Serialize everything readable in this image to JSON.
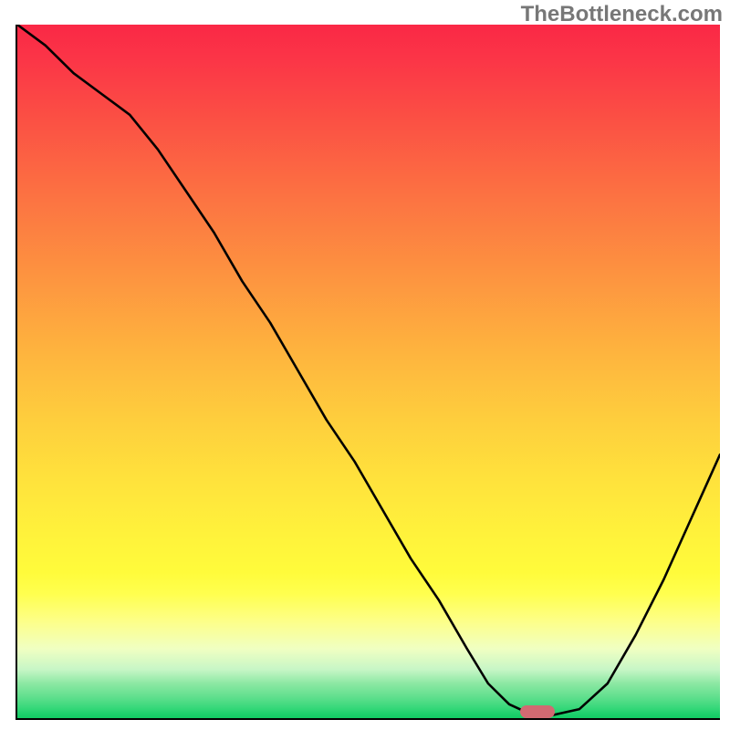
{
  "watermark": "TheBottleneck.com",
  "colors": {
    "gradient_top": "#fa2846",
    "gradient_mid": "#fed53c",
    "gradient_bottom": "#12cc63",
    "curve": "#000000",
    "marker": "#d16a72",
    "axis": "#000000",
    "watermark_text": "#777777"
  },
  "chart_data": {
    "type": "line",
    "title": "",
    "xlabel": "",
    "ylabel": "",
    "xlim": [
      0,
      100
    ],
    "ylim": [
      0,
      100
    ],
    "grid": false,
    "legend_position": "none",
    "note": "Bottleneck curve; y≈100 means extreme bottleneck, y≈0 means balanced. No numeric tick labels are shown on the image so values are read approximately from pixel position scaled to 0–100.",
    "series": [
      {
        "name": "bottleneck-curve",
        "x": [
          0,
          4,
          8,
          12,
          16,
          20,
          24,
          28,
          32,
          36,
          40,
          44,
          48,
          52,
          56,
          60,
          64,
          67,
          70,
          73,
          76,
          80,
          84,
          88,
          92,
          96,
          100
        ],
        "y": [
          100,
          97,
          93,
          90,
          87,
          82,
          76,
          70,
          63,
          57,
          50,
          43,
          37,
          30,
          23,
          17,
          10,
          5,
          2,
          0.6,
          0.4,
          1.3,
          5,
          12,
          20,
          29,
          38
        ]
      }
    ],
    "annotations": [
      {
        "name": "optimal-marker",
        "shape": "rounded-pill",
        "x": 74,
        "y": 0.5,
        "color": "#d16a72"
      }
    ]
  }
}
